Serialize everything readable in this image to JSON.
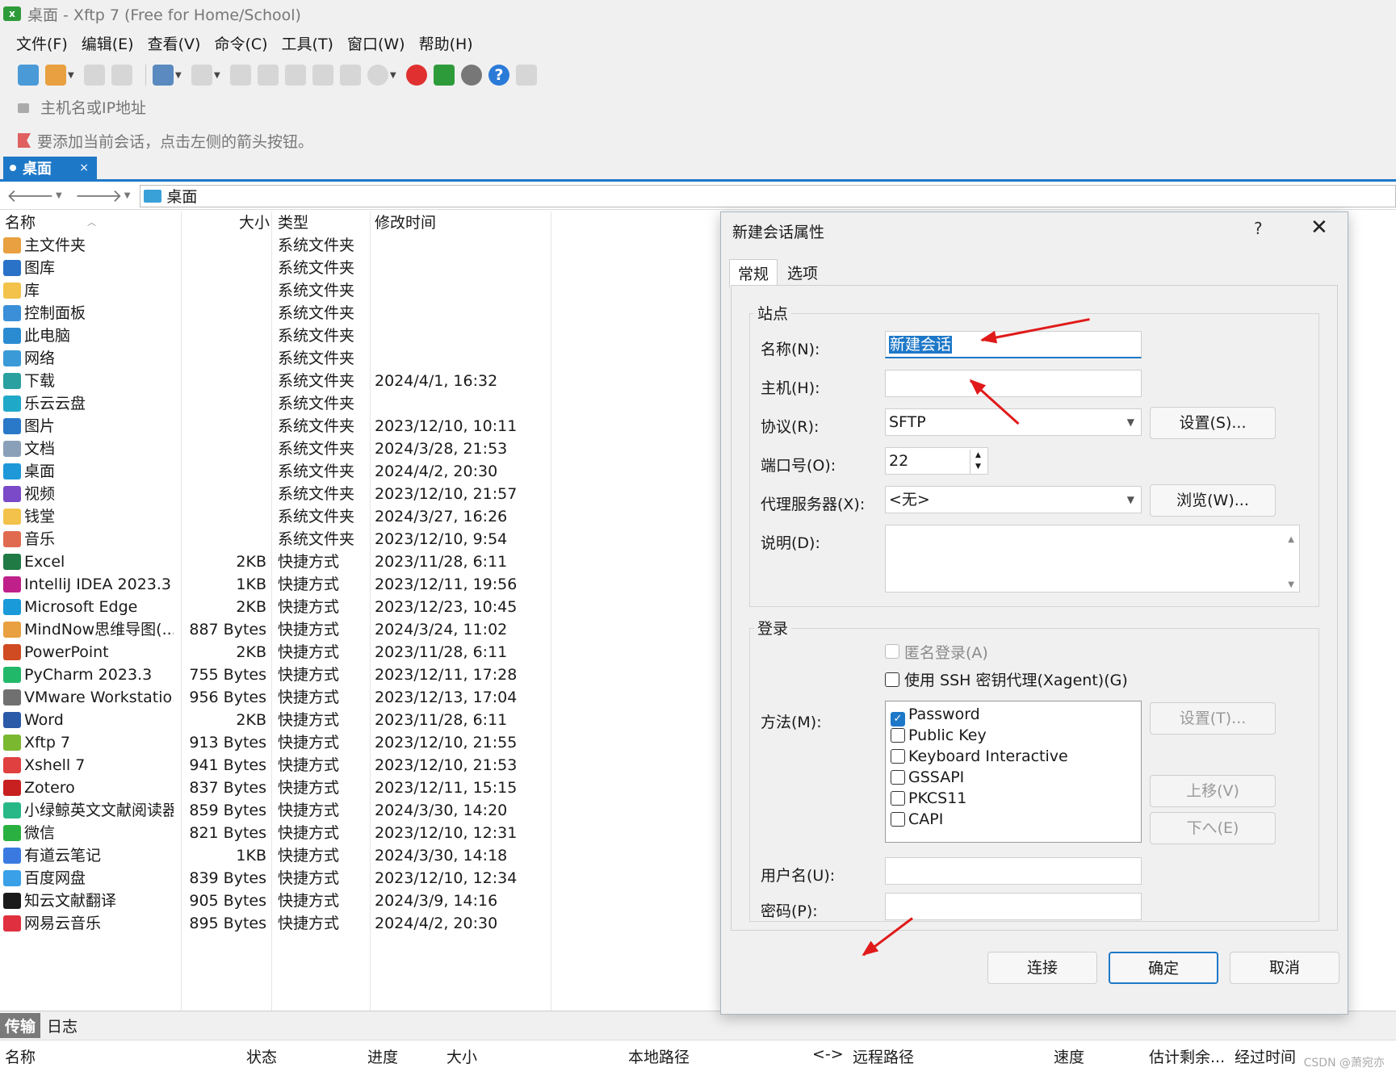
{
  "window": {
    "title": "桌面 - Xftp 7 (Free for Home/School)"
  },
  "menu": [
    "文件(F)",
    "编辑(E)",
    "查看(V)",
    "命令(C)",
    "工具(T)",
    "窗口(W)",
    "帮助(H)"
  ],
  "address": {
    "placeholder": "主机名或IP地址"
  },
  "hint": "要添加当前会话，点击左侧的箭头按钮。",
  "tab": {
    "label": "桌面",
    "close": "×"
  },
  "path": {
    "current": "桌面"
  },
  "columns": {
    "name": "名称",
    "size": "大小",
    "type": "类型",
    "modified": "修改时间"
  },
  "files": [
    {
      "name": "主文件夹",
      "size": "",
      "type": "系统文件夹",
      "modified": "",
      "icon": "home-icon",
      "color": "#e8a040"
    },
    {
      "name": "图库",
      "size": "",
      "type": "系统文件夹",
      "modified": "",
      "icon": "gallery-icon",
      "color": "#2a72c8"
    },
    {
      "name": "库",
      "size": "",
      "type": "系统文件夹",
      "modified": "",
      "icon": "library-icon",
      "color": "#f2c24a"
    },
    {
      "name": "控制面板",
      "size": "",
      "type": "系统文件夹",
      "modified": "",
      "icon": "control-panel-icon",
      "color": "#3a8fd8"
    },
    {
      "name": "此电脑",
      "size": "",
      "type": "系统文件夹",
      "modified": "",
      "icon": "computer-icon",
      "color": "#2a8bd0"
    },
    {
      "name": "网络",
      "size": "",
      "type": "系统文件夹",
      "modified": "",
      "icon": "network-icon",
      "color": "#3a9ad8"
    },
    {
      "name": "下载",
      "size": "",
      "type": "系统文件夹",
      "modified": "2024/4/1, 16:32",
      "icon": "download-icon",
      "color": "#2aa0a0"
    },
    {
      "name": "乐云云盘",
      "size": "",
      "type": "系统文件夹",
      "modified": "",
      "icon": "cloud-drive-icon",
      "color": "#20a8c8"
    },
    {
      "name": "图片",
      "size": "",
      "type": "系统文件夹",
      "modified": "2023/12/10, 10:11",
      "icon": "pictures-icon",
      "color": "#2a78c8"
    },
    {
      "name": "文档",
      "size": "",
      "type": "系统文件夹",
      "modified": "2024/3/28, 21:53",
      "icon": "documents-icon",
      "color": "#8aa0b8"
    },
    {
      "name": "桌面",
      "size": "",
      "type": "系统文件夹",
      "modified": "2024/4/2, 20:30",
      "icon": "desktop-icon",
      "color": "#1e98d8"
    },
    {
      "name": "视频",
      "size": "",
      "type": "系统文件夹",
      "modified": "2023/12/10, 21:57",
      "icon": "videos-icon",
      "color": "#7a4ac8"
    },
    {
      "name": "钱堂",
      "size": "",
      "type": "系统文件夹",
      "modified": "2024/3/27, 16:26",
      "icon": "folder-icon",
      "color": "#f2c24a"
    },
    {
      "name": "音乐",
      "size": "",
      "type": "系统文件夹",
      "modified": "2023/12/10, 9:54",
      "icon": "music-icon",
      "color": "#e06a50"
    },
    {
      "name": "Excel",
      "size": "2KB",
      "type": "快捷方式",
      "modified": "2023/11/28, 6:11",
      "icon": "excel-icon",
      "color": "#1f7a44"
    },
    {
      "name": "IntelliJ IDEA 2023.3",
      "size": "1KB",
      "type": "快捷方式",
      "modified": "2023/12/11, 19:56",
      "icon": "intellij-icon",
      "color": "#c0208a"
    },
    {
      "name": "Microsoft Edge",
      "size": "2KB",
      "type": "快捷方式",
      "modified": "2023/12/23, 10:45",
      "icon": "edge-icon",
      "color": "#1a9ad8"
    },
    {
      "name": "MindNow思维导图(...",
      "size": "887 Bytes",
      "type": "快捷方式",
      "modified": "2024/3/24, 11:02",
      "icon": "mindnow-icon",
      "color": "#e8a040"
    },
    {
      "name": "PowerPoint",
      "size": "2KB",
      "type": "快捷方式",
      "modified": "2023/11/28, 6:11",
      "icon": "powerpoint-icon",
      "color": "#d04a22"
    },
    {
      "name": "PyCharm 2023.3",
      "size": "755 Bytes",
      "type": "快捷方式",
      "modified": "2023/12/11, 17:28",
      "icon": "pycharm-icon",
      "color": "#22b86a"
    },
    {
      "name": "VMware Workstatio...",
      "size": "956 Bytes",
      "type": "快捷方式",
      "modified": "2023/12/13, 17:04",
      "icon": "vmware-icon",
      "color": "#707070"
    },
    {
      "name": "Word",
      "size": "2KB",
      "type": "快捷方式",
      "modified": "2023/11/28, 6:11",
      "icon": "word-icon",
      "color": "#2a5aa8"
    },
    {
      "name": "Xftp 7",
      "size": "913 Bytes",
      "type": "快捷方式",
      "modified": "2023/12/10, 21:55",
      "icon": "xftp-icon",
      "color": "#7ab830"
    },
    {
      "name": "Xshell 7",
      "size": "941 Bytes",
      "type": "快捷方式",
      "modified": "2023/12/10, 21:53",
      "icon": "xshell-icon",
      "color": "#e04040"
    },
    {
      "name": "Zotero",
      "size": "837 Bytes",
      "type": "快捷方式",
      "modified": "2023/12/11, 15:15",
      "icon": "zotero-icon",
      "color": "#c82020"
    },
    {
      "name": "小绿鲸英文文献阅读器",
      "size": "859 Bytes",
      "type": "快捷方式",
      "modified": "2024/3/30, 14:20",
      "icon": "whale-reader-icon",
      "color": "#28b888"
    },
    {
      "name": "微信",
      "size": "821 Bytes",
      "type": "快捷方式",
      "modified": "2023/12/10, 12:31",
      "icon": "wechat-icon",
      "color": "#2ab040"
    },
    {
      "name": "有道云笔记",
      "size": "1KB",
      "type": "快捷方式",
      "modified": "2024/3/30, 14:18",
      "icon": "youdao-note-icon",
      "color": "#3a7ae0"
    },
    {
      "name": "百度网盘",
      "size": "839 Bytes",
      "type": "快捷方式",
      "modified": "2023/12/10, 12:34",
      "icon": "baidu-pan-icon",
      "color": "#3aa0e8"
    },
    {
      "name": "知云文献翻译",
      "size": "905 Bytes",
      "type": "快捷方式",
      "modified": "2024/3/9, 14:16",
      "icon": "zhiyun-icon",
      "color": "#1a1a1a"
    },
    {
      "name": "网易云音乐",
      "size": "895 Bytes",
      "type": "快捷方式",
      "modified": "2024/4/2, 20:30",
      "icon": "netease-music-icon",
      "color": "#e03040"
    }
  ],
  "bottom": {
    "tabs": {
      "transfer": "传输",
      "log": "日志"
    },
    "columns": [
      "名称",
      "状态",
      "进度",
      "大小",
      "本地路径",
      "<->",
      "远程路径",
      "速度",
      "估计剩余...",
      "经过时间"
    ],
    "watermark": "CSDN @萧宛亦"
  },
  "dialog": {
    "title": "新建会话属性",
    "help": "?",
    "close": "✕",
    "tabs": {
      "general": "常规",
      "options": "选项"
    },
    "site_group": "站点",
    "name_label": "名称(N):",
    "name_value": "新建会话",
    "host_label": "主机(H):",
    "host_value": "",
    "protocol_label": "协议(R):",
    "protocol_value": "SFTP",
    "protocol_settings": "设置(S)...",
    "port_label": "端口号(O):",
    "port_value": "22",
    "proxy_label": "代理服务器(X):",
    "proxy_value": "<无>",
    "proxy_browse": "浏览(W)...",
    "desc_label": "说明(D):",
    "login_group": "登录",
    "anon_label": "匿名登录(A)",
    "anon_checked": false,
    "agent_label": "使用 SSH 密钥代理(Xagent)(G)",
    "agent_checked": false,
    "method_label": "方法(M):",
    "methods": [
      {
        "name": "Password",
        "checked": true
      },
      {
        "name": "Public Key",
        "checked": false
      },
      {
        "name": "Keyboard Interactive",
        "checked": false
      },
      {
        "name": "GSSAPI",
        "checked": false
      },
      {
        "name": "PKCS11",
        "checked": false
      },
      {
        "name": "CAPI",
        "checked": false
      }
    ],
    "method_settings": "设置(T)...",
    "move_up": "上移(V)",
    "move_down": "下へ(E)",
    "user_label": "用户名(U):",
    "user_value": "",
    "pass_label": "密码(P):",
    "pass_value": "",
    "connect": "连接",
    "ok": "确定",
    "cancel": "取消",
    "annotation_color": "#e01a1a"
  }
}
